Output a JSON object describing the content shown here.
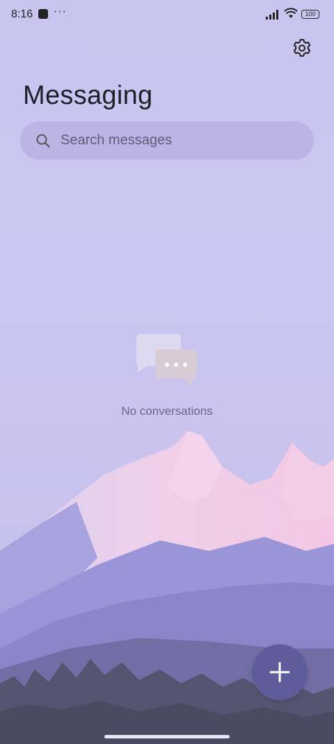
{
  "status_bar": {
    "time": "8:16",
    "more_indicator": "···",
    "battery_level": "100",
    "icons": [
      "app-notification-icon",
      "signal-icon",
      "wifi-icon",
      "battery-icon"
    ]
  },
  "header": {
    "title": "Messaging",
    "settings_icon": "gear-icon"
  },
  "search": {
    "placeholder": "Search messages",
    "icon": "search-icon"
  },
  "empty_state": {
    "icon": "chat-bubbles-icon",
    "text": "No conversations"
  },
  "fab": {
    "icon": "plus-icon",
    "color": "#5e5c9a"
  },
  "colors": {
    "background": "#cac5ef",
    "accent": "#5e5c9a"
  }
}
